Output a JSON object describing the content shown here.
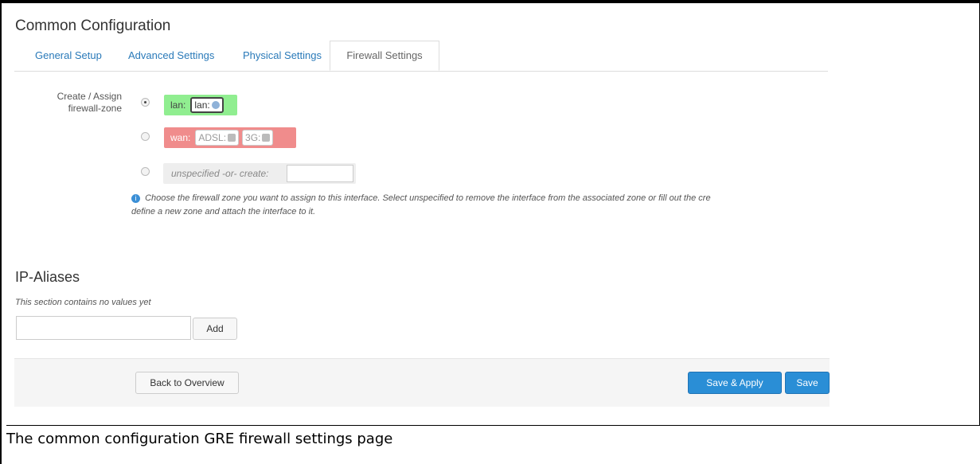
{
  "page_title": "Common Configuration",
  "tabs": [
    {
      "label": "General Setup"
    },
    {
      "label": "Advanced Settings"
    },
    {
      "label": "Physical Settings"
    },
    {
      "label": "Firewall Settings"
    }
  ],
  "firewall": {
    "field_label_line1": "Create / Assign",
    "field_label_line2": "firewall-zone",
    "options": [
      {
        "zone": "lan:",
        "interfaces": [
          "lan:"
        ],
        "selected": true
      },
      {
        "zone": "wan:",
        "interfaces": [
          "ADSL:",
          "3G:"
        ],
        "selected": false
      },
      {
        "zone": "unspecified -or- create:",
        "value": "",
        "selected": false
      }
    ],
    "help_line1": "Choose the firewall zone you want to assign to this interface. Select unspecified to remove the interface from the associated zone or fill out the cre",
    "help_line2": "define a new zone and attach the interface to it."
  },
  "ip_aliases": {
    "title": "IP-Aliases",
    "description": "This section contains no values yet",
    "input_value": "",
    "add_label": "Add"
  },
  "footer": {
    "back_label": "Back to Overview",
    "save_apply_label": "Save & Apply",
    "save_label": "Save"
  },
  "caption": "The common configuration GRE firewall settings page",
  "colors": {
    "lan_zone": "#90ee90",
    "wan_zone": "#f08c8c",
    "primary_button": "#2a8ed6",
    "link": "#2a7ab9"
  }
}
